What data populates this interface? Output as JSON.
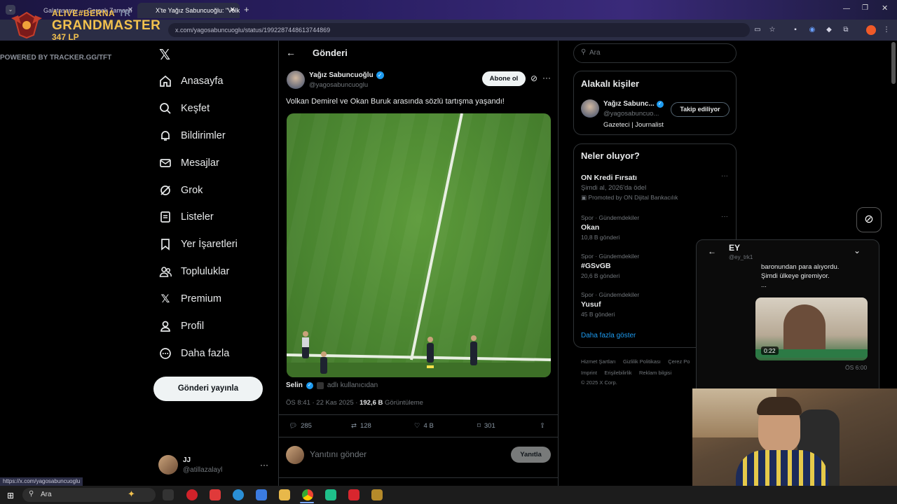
{
  "browser": {
    "tabs": [
      {
        "label": "Galatasaray — Gerçek Zamanlı"
      },
      {
        "label": "X'te Yağız Sabuncuoğlu: \"Volka"
      }
    ],
    "url": "x.com/yagosabuncuoglu/status/1992287448613744869",
    "status_url": "https://x.com/yagosabuncuoglu"
  },
  "tracker": {
    "name": "ALIVE#BERNA",
    "region": "TR",
    "rank": "GRANDMASTER",
    "lp": "347 LP",
    "powered": "POWERED BY TRACKER.GG/TFT"
  },
  "nav": {
    "items": [
      {
        "label": "Anasayfa",
        "icon": "home-icon"
      },
      {
        "label": "Keşfet",
        "icon": "search-icon"
      },
      {
        "label": "Bildirimler",
        "icon": "bell-icon"
      },
      {
        "label": "Mesajlar",
        "icon": "mail-icon"
      },
      {
        "label": "Grok",
        "icon": "grok-icon"
      },
      {
        "label": "Listeler",
        "icon": "list-icon"
      },
      {
        "label": "Yer İşaretleri",
        "icon": "bookmark-icon"
      },
      {
        "label": "Topluluklar",
        "icon": "people-icon"
      },
      {
        "label": "Premium",
        "icon": "x-logo-icon"
      },
      {
        "label": "Profil",
        "icon": "user-icon"
      },
      {
        "label": "Daha fazla",
        "icon": "more-circle-icon"
      }
    ],
    "post_button": "Gönderi yayınla",
    "account": {
      "name": "JJ",
      "handle": "@atillazalayl"
    }
  },
  "post": {
    "header_title": "Gönderi",
    "author_name": "Yağız Sabuncuoğlu",
    "author_handle": "@yagosabuncuoglu",
    "subscribe": "Abone ol",
    "text": "Volkan Demirel ve Okan Buruk arasında sözlü tartışma yaşandı!",
    "tag_user": "Selin",
    "tag_suffix": "adlı kullanıcıdan",
    "time": "ÖS 8:41 · 22 Kas 2025 ·",
    "views": "192,6 B",
    "views_label": "Görüntüleme",
    "replies": "285",
    "reposts": "128",
    "likes": "4 B",
    "bookmarks": "301",
    "reply_placeholder": "Yanıtını gönder",
    "reply_button": "Yanıtla"
  },
  "sidebar": {
    "search_placeholder": "Ara",
    "related_title": "Alakalı kişiler",
    "related": {
      "name": "Yağız Sabunc...",
      "handle": "@yagosabuncuo...",
      "bio": "Gazeteci | Journalist",
      "button": "Takip ediliyor"
    },
    "trends_title": "Neler oluyor?",
    "ad": {
      "title": "ON Kredi Fırsatı",
      "sub": "Şimdi al, 2026'da ödel",
      "promo": "Promoted by ON Dijital Bankacılık"
    },
    "trends": [
      {
        "meta": "Spor · Gündemdekiler",
        "title": "Okan",
        "count": "10,8 B gönderi"
      },
      {
        "meta": "Spor · Gündemdekiler",
        "title": "#GSvGB",
        "count": "20,6 B gönderi"
      },
      {
        "meta": "Spor · Gündemdekiler",
        "title": "Yusuf",
        "count": "45 B gönderi"
      }
    ],
    "show_more": "Daha fazla göster",
    "footer": [
      "Hizmet Şartları",
      "Gizlilik Politikası",
      "Çerez Po",
      "Imprint",
      "Erişilebilirlik",
      "Reklam bilgisi",
      "© 2025 X Corp."
    ]
  },
  "chat": {
    "name": "EY",
    "handle": "@ey_trk1",
    "message_lines": [
      "baronundan para alıyordu.",
      "Şimdi ülkeye giremiyor."
    ],
    "ellipsis": "...",
    "video_time": "0:22",
    "msg_time": "ÖS 6:00"
  },
  "taskbar": {
    "search_placeholder": "Ara"
  }
}
